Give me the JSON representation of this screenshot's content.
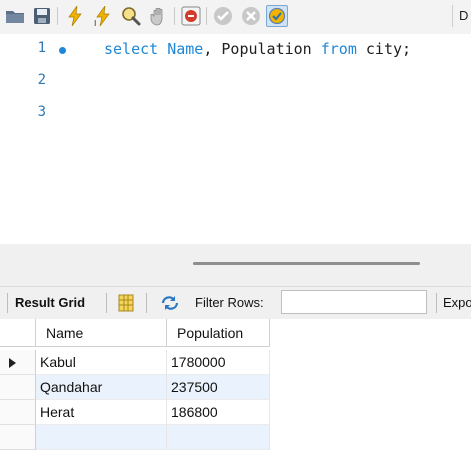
{
  "toolbar": {
    "buttons": [
      {
        "name": "open-folder-icon"
      },
      {
        "name": "save-icon"
      },
      {
        "name": "execute-icon"
      },
      {
        "name": "execute-current-icon"
      },
      {
        "name": "explain-icon"
      },
      {
        "name": "stop-icon"
      },
      {
        "name": "toggle-continue-on-error-icon"
      },
      {
        "name": "commit-icon"
      },
      {
        "name": "rollback-icon"
      },
      {
        "name": "autocommit-toggle-icon"
      }
    ],
    "trailing_text": "D"
  },
  "editor": {
    "lines": [
      {
        "number": "1",
        "has_marker": true,
        "parts": [
          {
            "text": "select ",
            "kind": "keyword"
          },
          {
            "text": "Name",
            "kind": "keyword"
          },
          {
            "text": ", Population ",
            "kind": "plain"
          },
          {
            "text": "from",
            "kind": "keyword"
          },
          {
            "text": " city;",
            "kind": "plain"
          }
        ]
      },
      {
        "number": "2",
        "has_marker": false,
        "parts": []
      },
      {
        "number": "3",
        "has_marker": false,
        "parts": []
      }
    ]
  },
  "result_bar": {
    "result_grid_label": "Result Grid",
    "filter_label": "Filter Rows:",
    "filter_value": "",
    "export_label": "Expo"
  },
  "grid": {
    "columns": [
      "Name",
      "Population"
    ],
    "rows": [
      {
        "name": "Kabul",
        "population": "1780000",
        "current": true
      },
      {
        "name": "Qandahar",
        "population": "237500",
        "current": false
      },
      {
        "name": "Herat",
        "population": "186800",
        "current": false
      }
    ]
  },
  "colors": {
    "keyword": "#1f87d8",
    "line_number": "#2f79b5",
    "alt_row": "#eaf3fd"
  }
}
